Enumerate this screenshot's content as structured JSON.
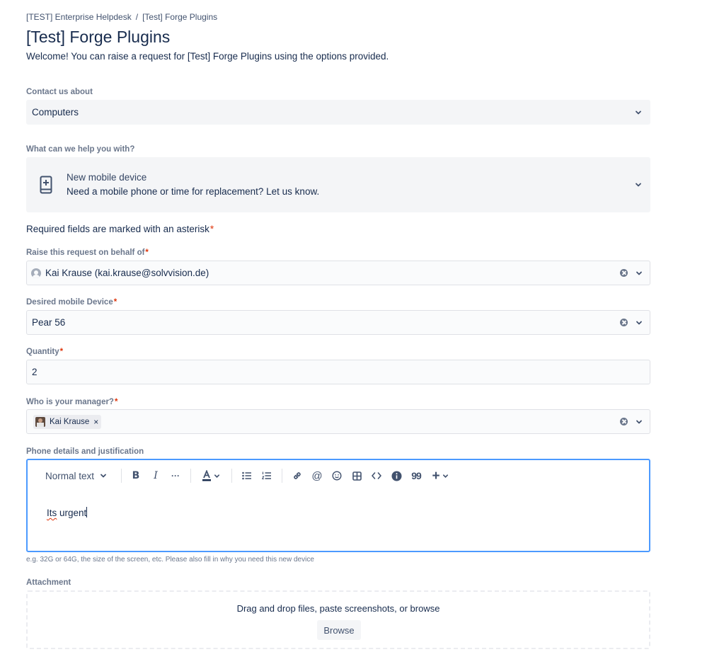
{
  "breadcrumb": {
    "root": "[TEST] Enterprise Helpdesk",
    "separator": "/",
    "current": "[Test] Forge Plugins"
  },
  "page": {
    "title": "[Test] Forge Plugins",
    "welcome": "Welcome! You can raise a request for [Test] Forge Plugins using the options provided."
  },
  "contact": {
    "label": "Contact us about",
    "value": "Computers"
  },
  "help": {
    "label": "What can we help you with?",
    "title": "New mobile device",
    "description": "Need a mobile phone or time for replacement? Let us know.",
    "icon": "mobile-add-icon"
  },
  "required_note": {
    "text": "Required fields are marked with an asterisk",
    "asterisk": "*"
  },
  "fields": {
    "on_behalf": {
      "label": "Raise this request on behalf of",
      "asterisk": "*",
      "value": "Kai Krause (kai.krause@solvvision.de)"
    },
    "device": {
      "label": "Desired mobile Device",
      "asterisk": "*",
      "value": "Pear 56"
    },
    "quantity": {
      "label": "Quantity",
      "asterisk": "*",
      "value": "2"
    },
    "manager": {
      "label": "Who is your manager?",
      "asterisk": "*",
      "chip": "Kai Krause",
      "chip_remove": "×"
    }
  },
  "editor": {
    "label": "Phone details and justification",
    "text_style": "Normal text",
    "content_misspelled": "Its",
    "content_rest": " urgent",
    "helper": "e.g. 32G or 64G, the size of the screen, etc. Please also fill in why you need this new device",
    "toolbar_icons": [
      "bold-icon",
      "italic-icon",
      "more-formatting-icon",
      "text-color-icon",
      "bullet-list-icon",
      "numbered-list-icon",
      "link-icon",
      "mention-icon",
      "emoji-icon",
      "table-icon",
      "code-icon",
      "info-panel-icon",
      "quote-icon",
      "insert-icon"
    ],
    "glyphs": {
      "bold": "B",
      "italic": "I",
      "more": "···",
      "mention": "@",
      "quote": "99",
      "plus": "+"
    }
  },
  "attachment": {
    "label": "Attachment",
    "dropzone_text": "Drag and drop files, paste screenshots, or browse",
    "browse_label": "Browse"
  },
  "colors": {
    "accent": "#4c9aff",
    "required": "#de350b",
    "text": "#172b4d",
    "subtle": "#6b778c",
    "field_bg": "#f4f5f7"
  }
}
